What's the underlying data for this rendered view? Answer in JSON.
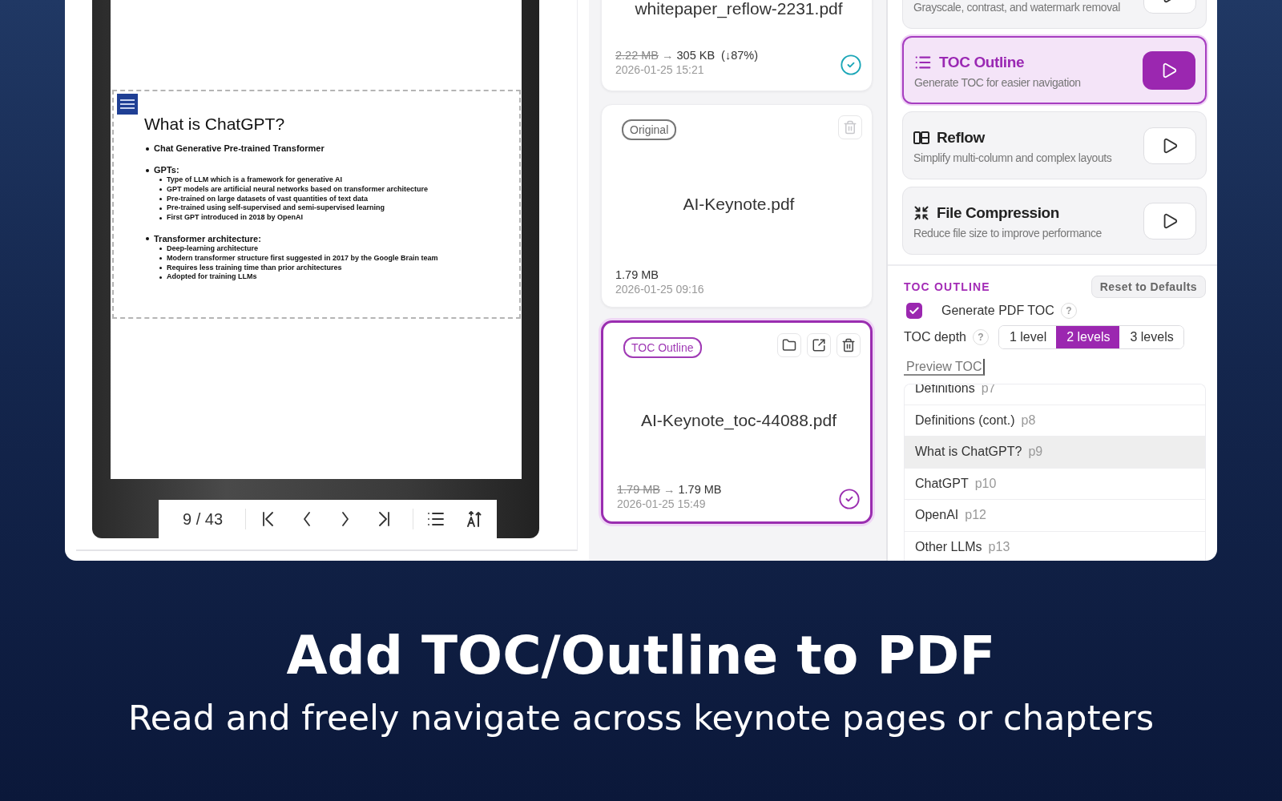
{
  "viewer": {
    "slide": {
      "title": "What is ChatGPT?",
      "bullets": [
        {
          "text": "Chat Generative Pre-trained Transformer"
        },
        {
          "text": "GPTs:",
          "children": [
            {
              "text": "Type of LLM which is a framework for generative AI"
            },
            {
              "text": "GPT models are artificial neural networks based on transformer architecture"
            },
            {
              "text": "Pre-trained on large datasets of vast quantities of text data"
            },
            {
              "text": "Pre-trained using self-supervised and semi-supervised learning"
            },
            {
              "text": "First GPT introduced in 2018 by OpenAI"
            }
          ]
        },
        {
          "text": "Transformer architecture:",
          "children": [
            {
              "text": "Deep-learning architecture"
            },
            {
              "text": "Modern transformer structure first suggested in 2017 by the Google Brain team"
            },
            {
              "text": "Requires less training time than prior architectures"
            },
            {
              "text": "Adopted for training LLMs"
            }
          ]
        }
      ]
    },
    "page_indicator": "9 / 43"
  },
  "files": [
    {
      "name": "whitepaper_reflow-2231.pdf",
      "old_size": "2.22 MB",
      "arrow": "→",
      "new_size": "305 KB",
      "saving": "(↓87%)",
      "date": "2026-01-25 15:21",
      "done": true,
      "selected": false
    },
    {
      "tag": "Original",
      "name": "AI-Keynote.pdf",
      "new_size": "1.79 MB",
      "date": "2026-01-25 09:16",
      "done": false,
      "selected": false,
      "actions": [
        {
          "kind": "trash",
          "disabled": true
        }
      ]
    },
    {
      "tag": "TOC Outline",
      "name": "AI-Keynote_toc-44088.pdf",
      "old_size": "1.79 MB",
      "arrow": "→",
      "new_size": "1.79 MB",
      "date": "2026-01-25 15:49",
      "done": true,
      "selected": true,
      "actions": [
        {
          "kind": "folder",
          "disabled": false
        },
        {
          "kind": "open",
          "disabled": false
        },
        {
          "kind": "trash",
          "disabled": false
        }
      ]
    }
  ],
  "tools": [
    {
      "description": "Grayscale, contrast, and watermark removal",
      "selected": false
    },
    {
      "kind": "list",
      "title": "TOC Outline",
      "description": "Generate TOC for easier navigation",
      "selected": true
    },
    {
      "kind": "columns",
      "title": "Reflow",
      "description": "Simplify multi-column and complex layouts",
      "selected": false
    },
    {
      "kind": "compress",
      "title": "File Compression",
      "description": "Reduce file size to improve performance",
      "selected": false
    }
  ],
  "settings": {
    "title": "TOC OUTLINE",
    "reset": "Reset to Defaults",
    "generate": {
      "label": "Generate PDF TOC",
      "checked": true,
      "help": "?"
    },
    "depth": {
      "label": "TOC depth",
      "help": "?",
      "options": [
        {
          "label": "1 level",
          "selected": false
        },
        {
          "label": "2 levels",
          "selected": true
        },
        {
          "label": "3 levels",
          "selected": false
        }
      ]
    },
    "preview": "Preview TOC",
    "toc_items": [
      {
        "title": "Definitions",
        "page": "p7",
        "selected": false
      },
      {
        "title": "Definitions (cont.)",
        "page": "p8",
        "selected": false
      },
      {
        "title": "What is ChatGPT?",
        "page": "p9",
        "selected": true
      },
      {
        "title": "ChatGPT",
        "page": "p10",
        "selected": false
      },
      {
        "title": "OpenAI",
        "page": "p12",
        "selected": false
      },
      {
        "title": "Other LLMs",
        "page": "p13",
        "selected": false
      }
    ]
  },
  "headline": "Add TOC/Outline to PDF",
  "subtitle": "Read and freely navigate across keynote pages or chapters"
}
